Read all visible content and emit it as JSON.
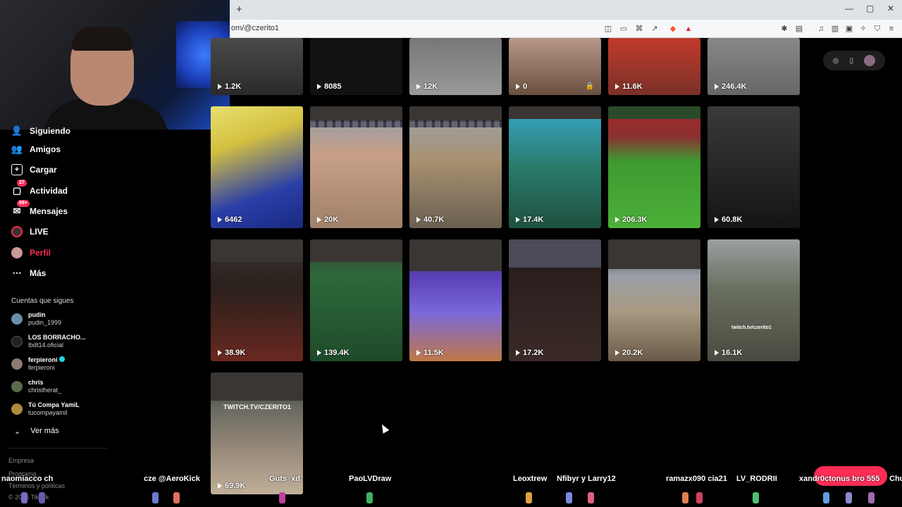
{
  "browser": {
    "new_tab": "+",
    "url": "om/@czerito1",
    "window_controls": [
      "—",
      "▢",
      "✕"
    ]
  },
  "sidebar": {
    "items": [
      {
        "label": "Siguiendo",
        "icon": "following-icon"
      },
      {
        "label": "Amigos",
        "icon": "friends-icon"
      },
      {
        "label": "Cargar",
        "icon": "upload-icon"
      },
      {
        "label": "Actividad",
        "icon": "activity-icon",
        "badge": "27"
      },
      {
        "label": "Mensajes",
        "icon": "messages-icon",
        "badge": "99+"
      },
      {
        "label": "LIVE",
        "icon": "live-icon"
      },
      {
        "label": "Perfil",
        "icon": "profile-icon",
        "active": true
      },
      {
        "label": "Más",
        "icon": "more-icon"
      }
    ],
    "following_title": "Cuentas que sigues",
    "accounts": [
      {
        "name": "pudin",
        "handle": "pudin_1999",
        "verified": false
      },
      {
        "name": "LOS BORRACHO...",
        "handle": "lbdt14.oficial",
        "verified": false
      },
      {
        "name": "ferpieroni",
        "handle": "ferpieroni",
        "verified": true
      },
      {
        "name": "chris",
        "handle": "christherat_",
        "verified": false
      },
      {
        "name": "Tú Compa YamiL",
        "handle": "tucompayamil",
        "verified": false
      }
    ],
    "see_more": "Ver más",
    "footer": [
      "Empresa",
      "Programa",
      "Términos y políticas",
      "© 2025 TikTok"
    ]
  },
  "videos": [
    {
      "views": "1.2K",
      "locked": false
    },
    {
      "views": "8085",
      "locked": false
    },
    {
      "views": "12K",
      "locked": false
    },
    {
      "views": "0",
      "locked": true
    },
    {
      "views": "11.6K",
      "locked": false
    },
    {
      "views": "246.4K",
      "locked": false
    },
    {
      "views": "6462",
      "locked": false
    },
    {
      "views": "20K",
      "locked": false
    },
    {
      "views": "40.7K",
      "locked": false
    },
    {
      "views": "17.4K",
      "locked": false
    },
    {
      "views": "206.3K",
      "locked": false
    },
    {
      "views": "60.8K",
      "locked": false
    },
    {
      "views": "38.9K",
      "locked": false
    },
    {
      "views": "139.4K",
      "locked": false
    },
    {
      "views": "11.5K",
      "locked": false
    },
    {
      "views": "17.2K",
      "locked": false
    },
    {
      "views": "20.2K",
      "locked": false
    },
    {
      "views": "16.1K",
      "locked": false,
      "caption": "twitch.tv/czerito1"
    },
    {
      "views": "69.9K",
      "locked": false,
      "caption": "TWITCH.TV/CZERITO1"
    }
  ],
  "overlay_names": [
    "naomiacco ch",
    "cze @AeroKick",
    "Guts_xd",
    "PaoLVDraw",
    "Leoxtrew",
    "Nfibyr y Larry12",
    "ramazx090 cia21",
    "LV_RODRII",
    "xandr0ctonus bro 555",
    "Chu"
  ],
  "colors": {
    "accent": "#fe2c55",
    "verified": "#20d5ec"
  }
}
